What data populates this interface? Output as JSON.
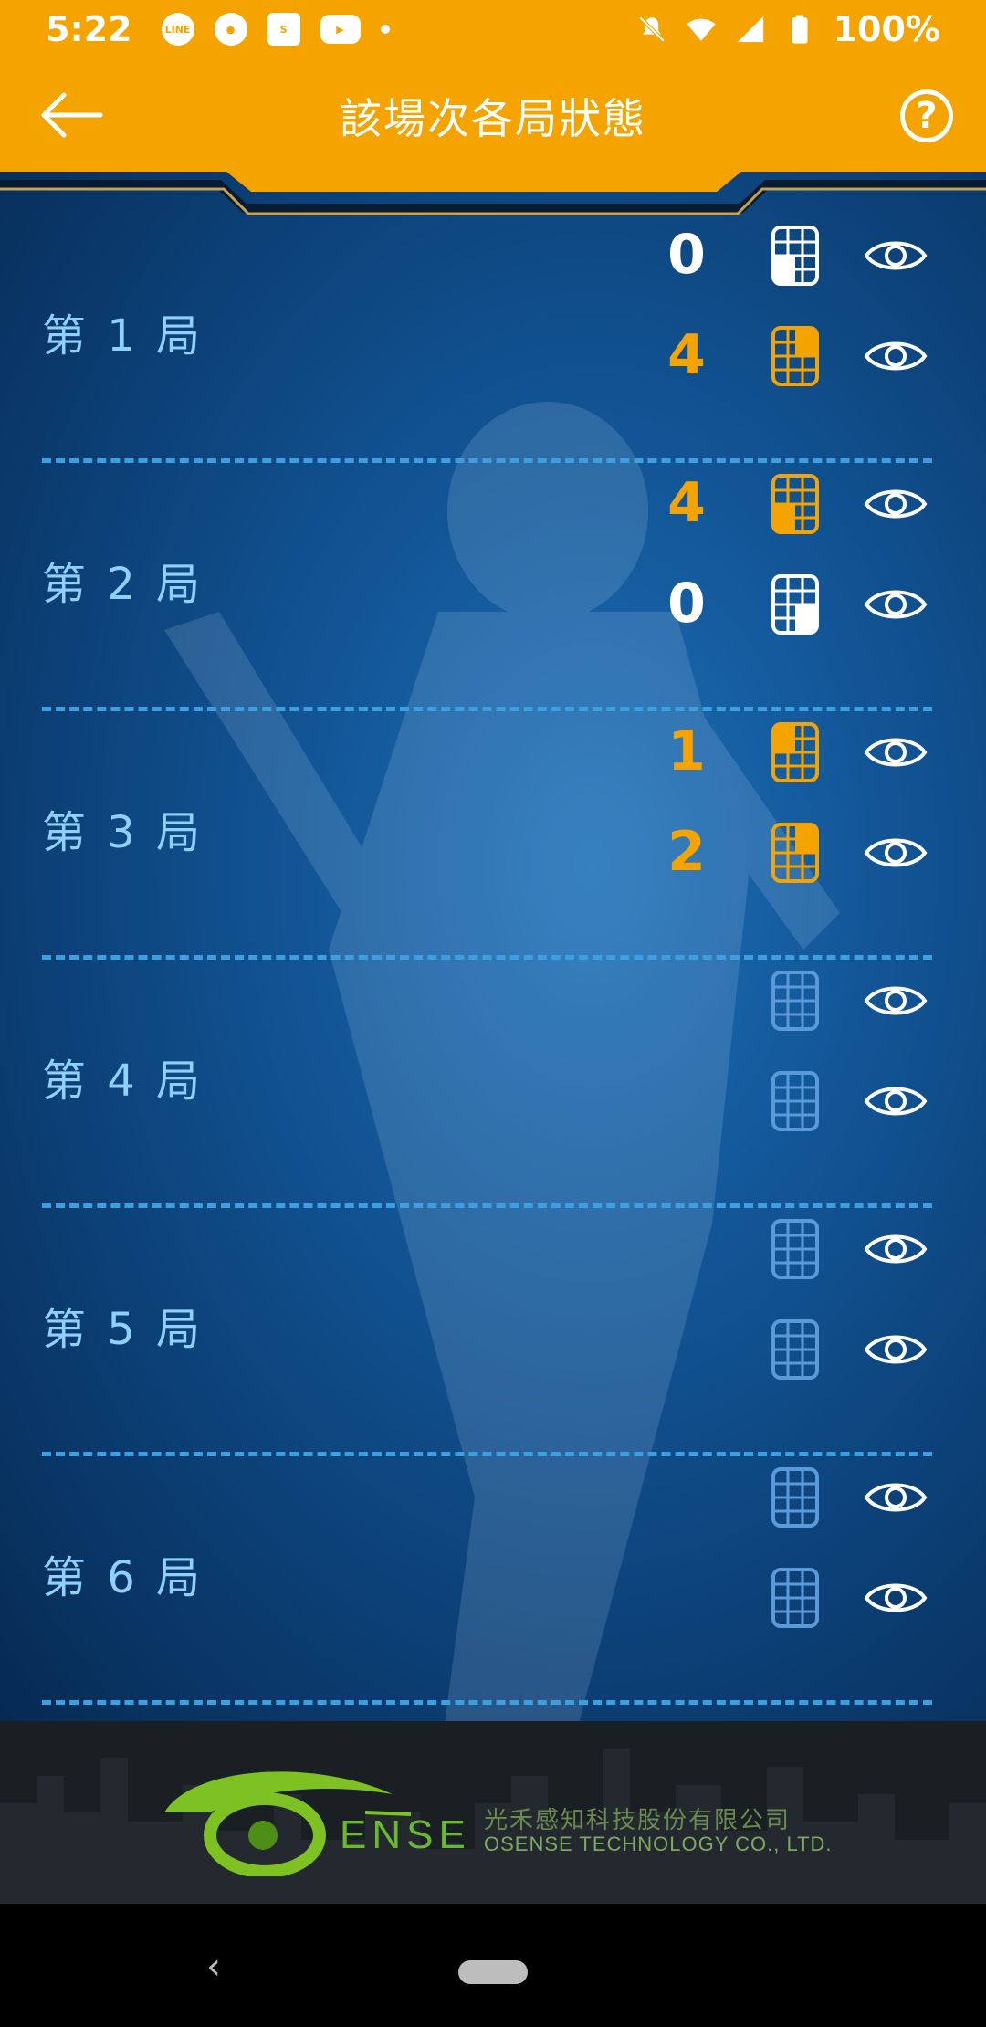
{
  "status_bar": {
    "time": "5:22",
    "left_icons": [
      "line-icon",
      "app-icon",
      "shopping-icon",
      "youtube-icon",
      "dot-icon"
    ],
    "right_icons": [
      "mute-icon",
      "wifi-icon",
      "signal-icon",
      "battery-icon"
    ],
    "battery": "100%"
  },
  "app_bar": {
    "title": "該場次各局狀態",
    "back_icon": "arrow-left-icon",
    "help_icon": "question-circle-icon"
  },
  "colors": {
    "accent": "#f5a300",
    "label": "#8fd0ff",
    "divider": "#3e9fe0",
    "white": "#ffffff"
  },
  "innings": [
    {
      "label": "第 1 局",
      "rows": [
        {
          "score": "0",
          "color": "white",
          "quadrant": "bottom-left"
        },
        {
          "score": "4",
          "color": "orange",
          "quadrant": "top-right"
        }
      ]
    },
    {
      "label": "第 2 局",
      "rows": [
        {
          "score": "4",
          "color": "orange",
          "quadrant": "bottom-left"
        },
        {
          "score": "0",
          "color": "white",
          "quadrant": "bottom-right"
        }
      ]
    },
    {
      "label": "第 3 局",
      "rows": [
        {
          "score": "1",
          "color": "orange",
          "quadrant": "top-left"
        },
        {
          "score": "2",
          "color": "orange",
          "quadrant": "top-right"
        }
      ]
    },
    {
      "label": "第 4 局",
      "rows": [
        {
          "score": "",
          "color": "dim",
          "quadrant": "none"
        },
        {
          "score": "",
          "color": "dim",
          "quadrant": "none"
        }
      ]
    },
    {
      "label": "第 5 局",
      "rows": [
        {
          "score": "",
          "color": "dim",
          "quadrant": "none"
        },
        {
          "score": "",
          "color": "dim",
          "quadrant": "none"
        }
      ]
    },
    {
      "label": "第 6 局",
      "rows": [
        {
          "score": "",
          "color": "dim",
          "quadrant": "none"
        },
        {
          "score": "",
          "color": "dim",
          "quadrant": "none"
        }
      ]
    }
  ],
  "footer": {
    "logo_text": "ENSE",
    "company_cn": "光禾感知科技股份有限公司",
    "company_en": "OSENSE TECHNOLOGY CO., LTD."
  },
  "nav_bar": {
    "back_icon": "chevron-left-icon",
    "home_icon": "home-pill-icon"
  }
}
